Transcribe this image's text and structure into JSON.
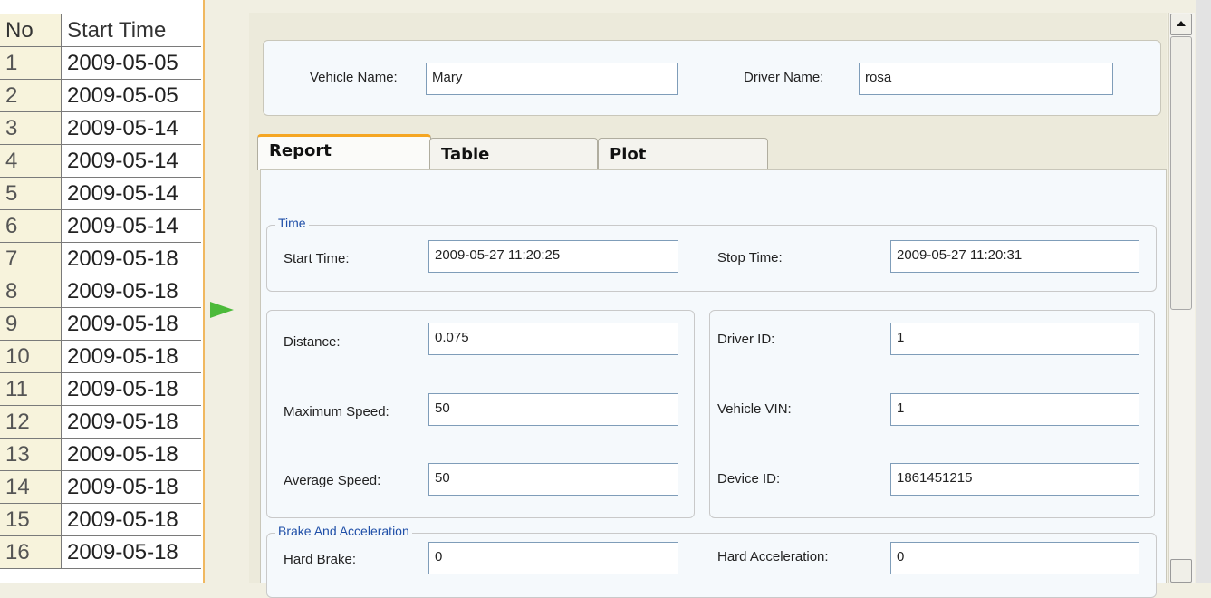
{
  "list": {
    "header": {
      "no": "No",
      "start": "Start Time"
    },
    "rows": [
      {
        "no": "1",
        "start": "2009-05-05"
      },
      {
        "no": "2",
        "start": "2009-05-05"
      },
      {
        "no": "3",
        "start": "2009-05-14"
      },
      {
        "no": "4",
        "start": "2009-05-14"
      },
      {
        "no": "5",
        "start": "2009-05-14"
      },
      {
        "no": "6",
        "start": "2009-05-14"
      },
      {
        "no": "7",
        "start": "2009-05-18"
      },
      {
        "no": "8",
        "start": "2009-05-18"
      },
      {
        "no": "9",
        "start": "2009-05-18"
      },
      {
        "no": "10",
        "start": "2009-05-18"
      },
      {
        "no": "11",
        "start": "2009-05-18"
      },
      {
        "no": "12",
        "start": "2009-05-18"
      },
      {
        "no": "13",
        "start": "2009-05-18"
      },
      {
        "no": "14",
        "start": "2009-05-18"
      },
      {
        "no": "15",
        "start": "2009-05-18"
      },
      {
        "no": "16",
        "start": "2009-05-18"
      }
    ],
    "selected_marker_icon": "play-arrow-icon"
  },
  "vehicle": {
    "vehicle_name_label": "Vehicle Name:",
    "vehicle_name_value": "Mary",
    "driver_name_label": "Driver Name:",
    "driver_name_value": "rosa"
  },
  "tabs": [
    "Report",
    "Table",
    "Plot"
  ],
  "report": {
    "time_group": "Time",
    "start_time_label": "Start Time:",
    "start_time_value": "2009-05-27 11:20:25",
    "stop_time_label": "Stop Time:",
    "stop_time_value": "2009-05-27 11:20:31",
    "distance_label": "Distance:",
    "distance_value": "0.075",
    "max_speed_label": "Maximum Speed:",
    "max_speed_value": "50",
    "avg_speed_label": "Average Speed:",
    "avg_speed_value": "50",
    "driver_id_label": "Driver ID:",
    "driver_id_value": "1",
    "vin_label": "Vehicle VIN:",
    "vin_value": "1",
    "device_id_label": "Device ID:",
    "device_id_value": "1861451215",
    "brake_group": "Brake And Acceleration",
    "hard_brake_label": "Hard Brake:",
    "hard_brake_value": "0",
    "hard_accel_label": "Hard Acceleration:",
    "hard_accel_value": "0"
  },
  "colors": {
    "accent_tab": "#f5a623",
    "group_title": "#1f4fa8",
    "marker": "#4cba3a",
    "list_border": "#f0b860"
  }
}
